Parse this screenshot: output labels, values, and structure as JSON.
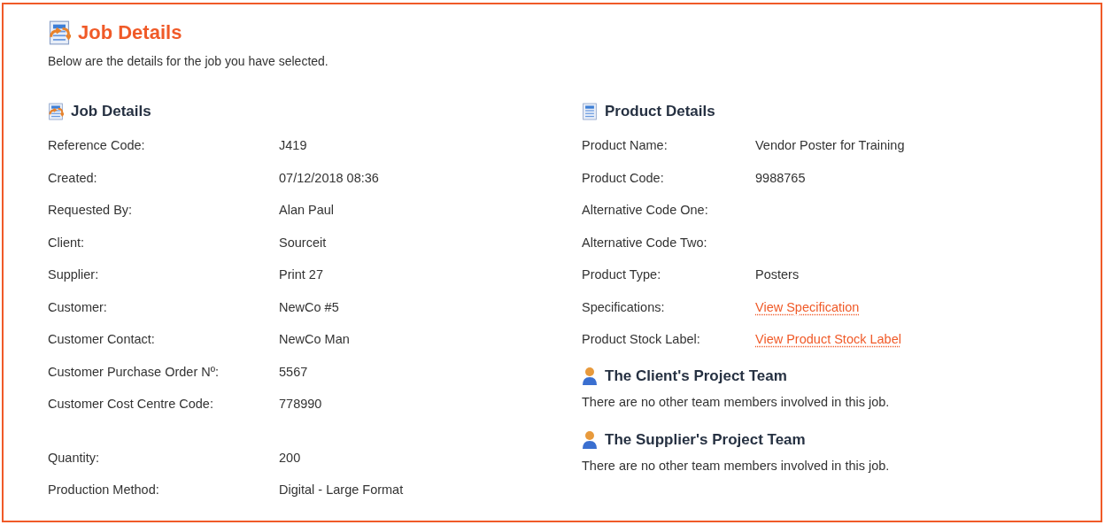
{
  "page": {
    "title": "Job Details",
    "intro": "Below are the details for the job you have selected."
  },
  "job_details": {
    "title": "Job Details",
    "groups": [
      [
        {
          "label": "Reference Code:",
          "value": "J419"
        },
        {
          "label": "Created:",
          "value": "07/12/2018 08:36"
        },
        {
          "label": "Requested By:",
          "value": "Alan Paul"
        },
        {
          "label": "Client:",
          "value": "Sourceit"
        },
        {
          "label": "Supplier:",
          "value": "Print 27"
        },
        {
          "label": "Customer:",
          "value": "NewCo #5"
        },
        {
          "label": "Customer Contact:",
          "value": "NewCo Man"
        },
        {
          "label": "Customer Purchase Order Nº:",
          "value": "5567"
        },
        {
          "label": "Customer Cost Centre Code:",
          "value": "778990"
        }
      ],
      [
        {
          "label": "Quantity:",
          "value": "200"
        },
        {
          "label": "Production Method:",
          "value": "Digital - Large Format"
        }
      ]
    ]
  },
  "product_details": {
    "title": "Product Details",
    "rows": [
      {
        "kind": "text",
        "label": "Product Name:",
        "value": "Vendor Poster for Training"
      },
      {
        "kind": "text",
        "label": "Product Code:",
        "value": "9988765"
      },
      {
        "kind": "empty",
        "label": "Alternative Code One:"
      },
      {
        "kind": "empty",
        "label": "Alternative Code Two:"
      },
      {
        "kind": "text",
        "label": "Product Type:",
        "value": "Posters"
      },
      {
        "kind": "link",
        "label": "Specifications:",
        "value": "View Specification"
      },
      {
        "kind": "link",
        "label": "Product Stock Label:",
        "value": "View Product Stock Label"
      }
    ]
  },
  "teams": [
    {
      "title": "The Client's Project Team",
      "message": "There are no other team members involved in this job."
    },
    {
      "title": "The Supplier's Project Team",
      "message": "There are no other team members involved in this job."
    }
  ]
}
